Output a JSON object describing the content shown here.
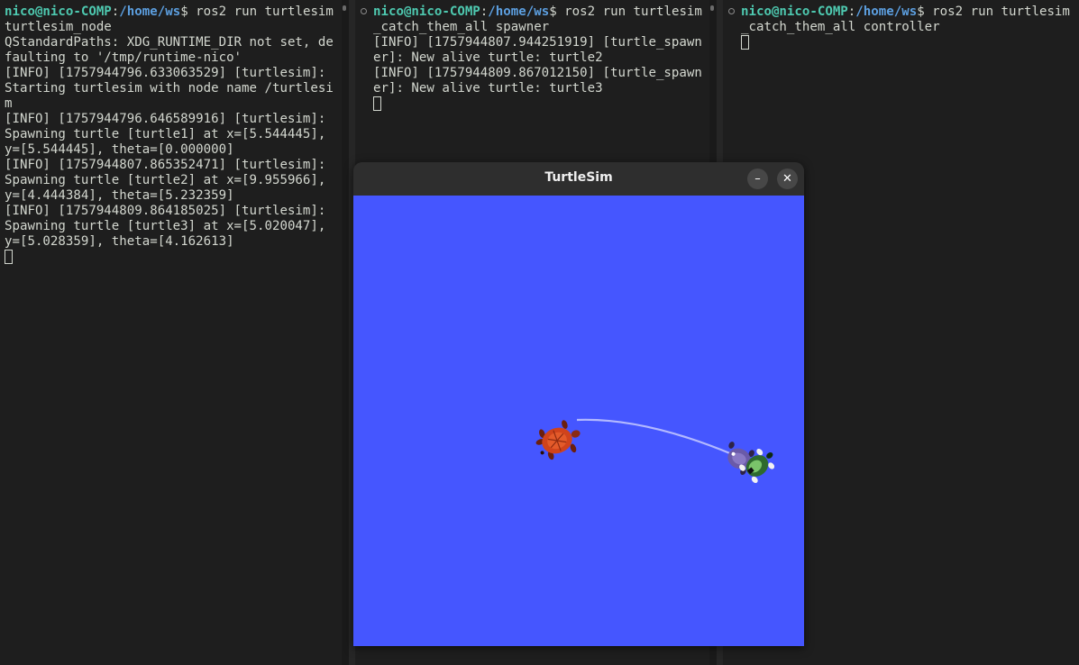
{
  "terminals": [
    {
      "user": "nico@nico-COMP",
      "sep": ":",
      "path": "/home/ws",
      "prompt_end": "$ ",
      "command": "ros2 run turtlesim turtlesim_node",
      "output": "QStandardPaths: XDG_RUNTIME_DIR not set, defaulting to '/tmp/runtime-nico'\n[INFO] [1757944796.633063529] [turtlesim]: Starting turtlesim with node name /turtlesim\n[INFO] [1757944796.646589916] [turtlesim]: Spawning turtle [turtle1] at x=[5.544445], y=[5.544445], theta=[0.000000]\n[INFO] [1757944807.865352471] [turtlesim]: Spawning turtle [turtle2] at x=[9.955966], y=[4.444384], theta=[5.232359]\n[INFO] [1757944809.864185025] [turtlesim]: Spawning turtle [turtle3] at x=[5.020047], y=[5.028359], theta=[4.162613]\n"
    },
    {
      "user": "nico@nico-COMP",
      "sep": ":",
      "path": "/home/ws",
      "prompt_end": "$ ",
      "command": "ros2 run turtlesim_catch_them_all spawner",
      "output": "[INFO] [1757944807.944251919] [turtle_spawner]: New alive turtle: turtle2\n[INFO] [1757944809.867012150] [turtle_spawner]: New alive turtle: turtle3\n"
    },
    {
      "user": "nico@nico-COMP",
      "sep": ":",
      "path": "/home/ws",
      "prompt_end": "$ ",
      "command": "ros2 run turtlesim_catch_them_all controller",
      "output": "\n"
    }
  ],
  "turtlesim_window": {
    "title": "TurtleSim",
    "minimize_glyph": "–",
    "close_glyph": "✕",
    "background_color": "#4556ff",
    "trail_color": "#b3b9ff"
  }
}
